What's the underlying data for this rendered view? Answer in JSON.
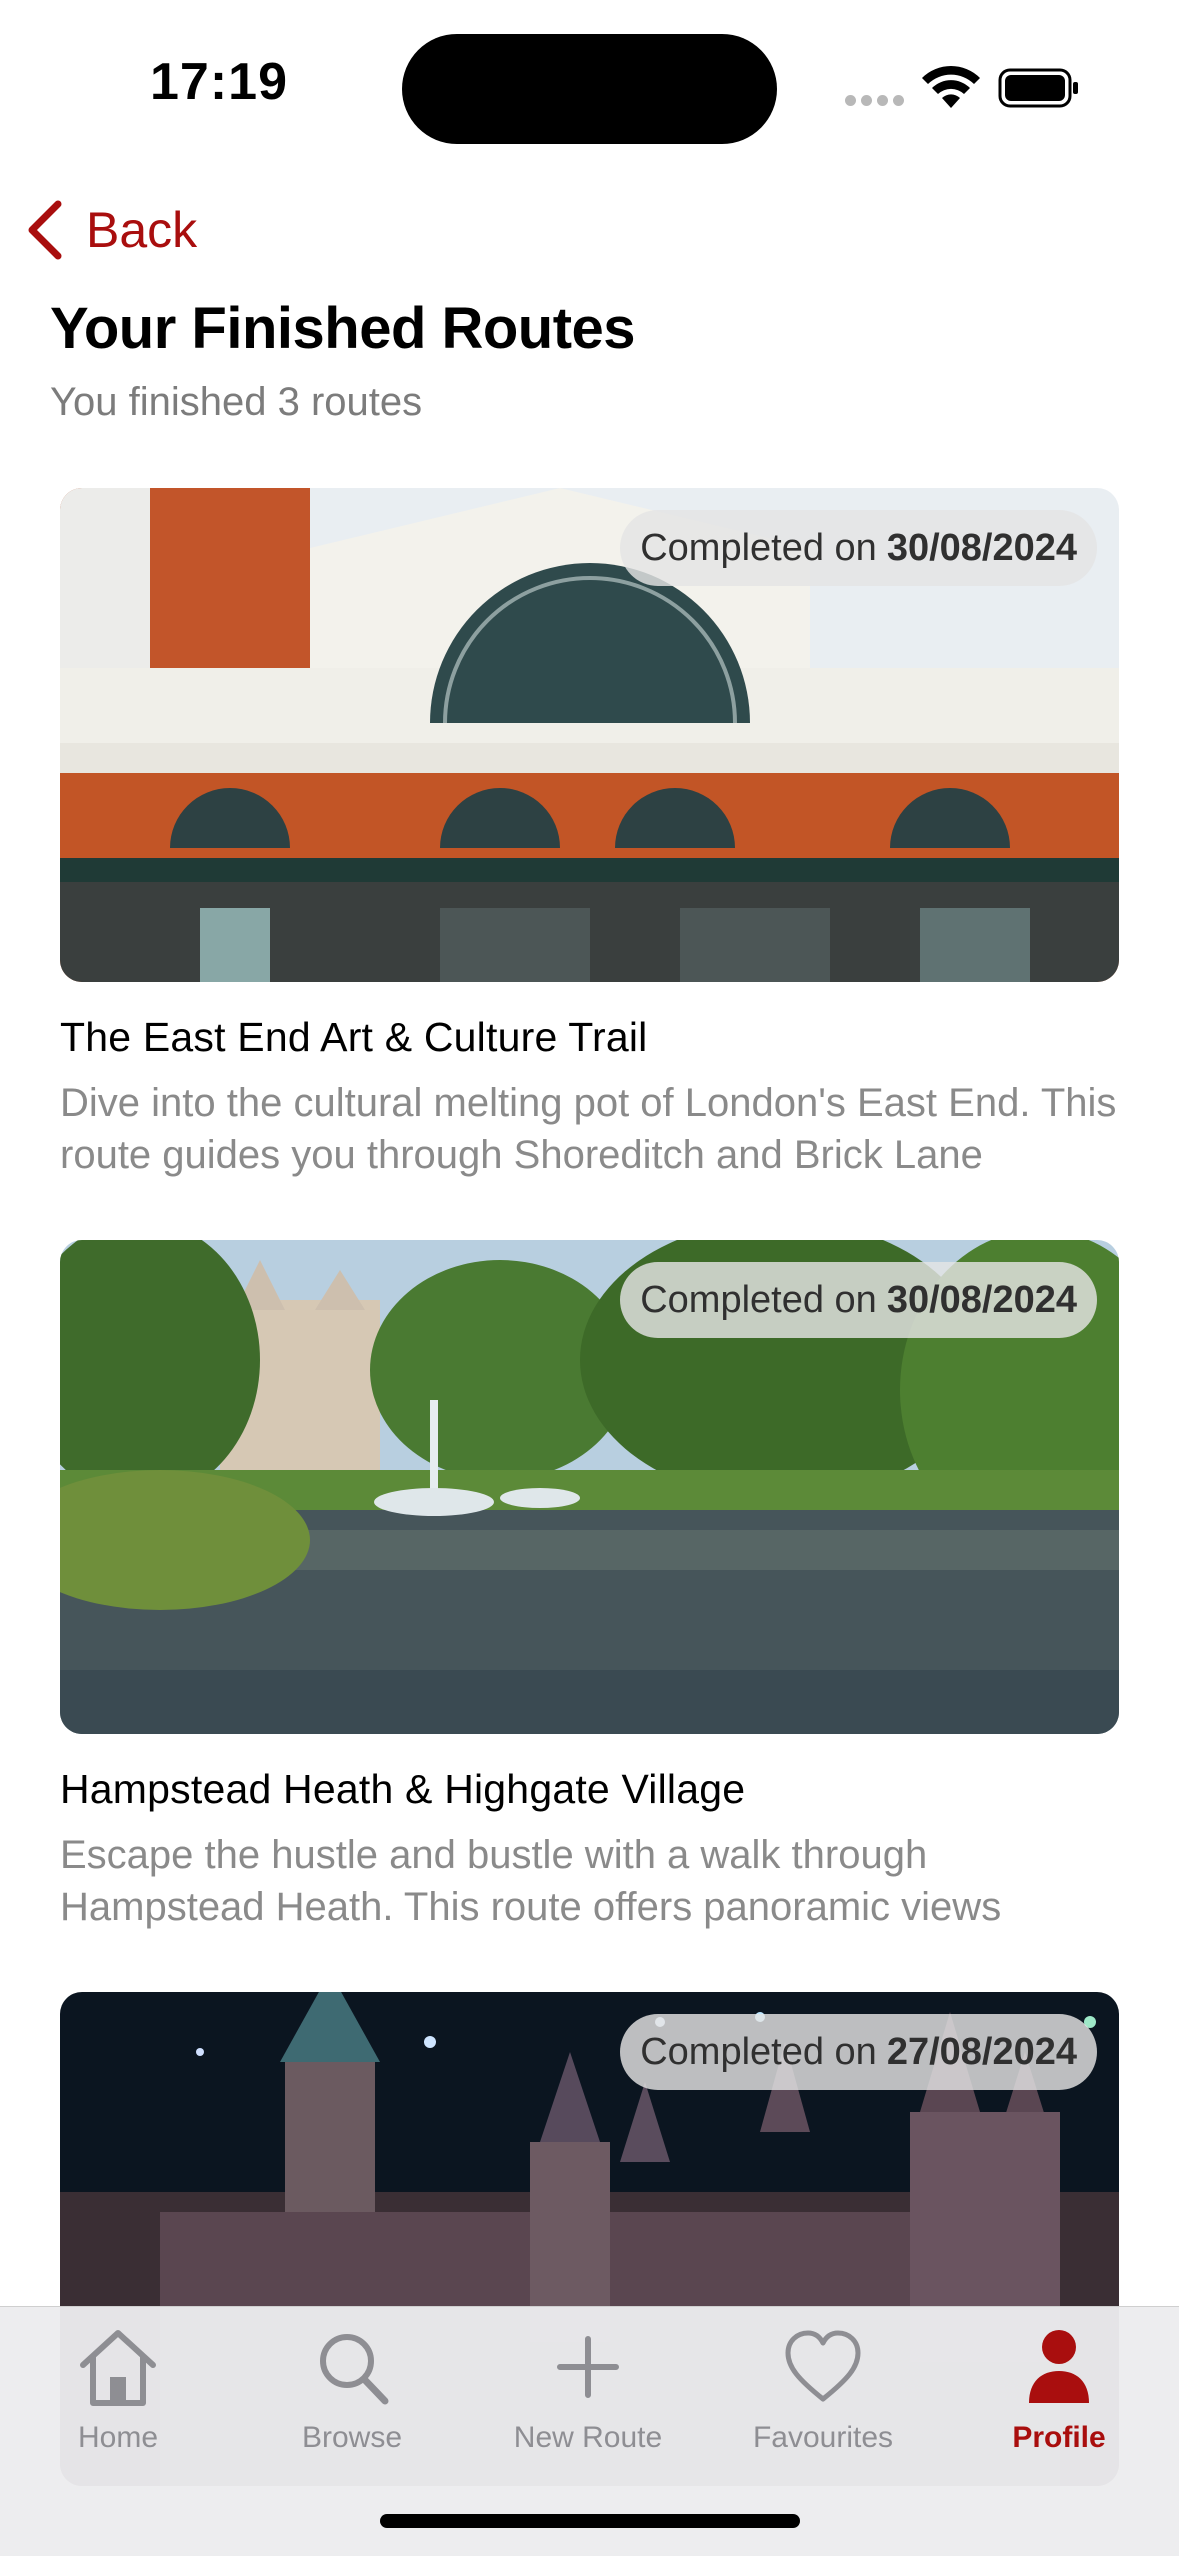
{
  "status_bar": {
    "time": "17:19"
  },
  "nav": {
    "back_label": "Back"
  },
  "page": {
    "title": "Your Finished Routes",
    "subtitle": "You finished 3 routes"
  },
  "routes": [
    {
      "completed_prefix": "Completed on",
      "completed_date": "30/08/2024",
      "title": "The East End Art & Culture Trail",
      "description": "Dive into the cultural melting pot of London's East End. This route guides you through Shoreditch and Brick Lane",
      "image": "london-transport-museum-facade"
    },
    {
      "completed_prefix": "Completed on",
      "completed_date": "30/08/2024",
      "title": "Hampstead Heath & Highgate Village",
      "description": "Escape the hustle and bustle with a walk through Hampstead Heath. This route offers panoramic views",
      "image": "park-lake-with-fountain"
    },
    {
      "completed_prefix": "Completed on",
      "completed_date": "27/08/2024",
      "title": "",
      "description": "",
      "image": "castle-model-at-night"
    }
  ],
  "tab_bar": {
    "tabs": [
      {
        "label": "Home",
        "icon": "house-icon"
      },
      {
        "label": "Browse",
        "icon": "magnifier-icon"
      },
      {
        "label": "New Route",
        "icon": "plus-icon"
      },
      {
        "label": "Favourites",
        "icon": "heart-icon"
      },
      {
        "label": "Profile",
        "icon": "person-icon",
        "active": true
      }
    ]
  },
  "colors": {
    "accent": "#a90e0e",
    "muted_text": "#8a8a8a",
    "inactive_tab": "#8e8e93"
  }
}
